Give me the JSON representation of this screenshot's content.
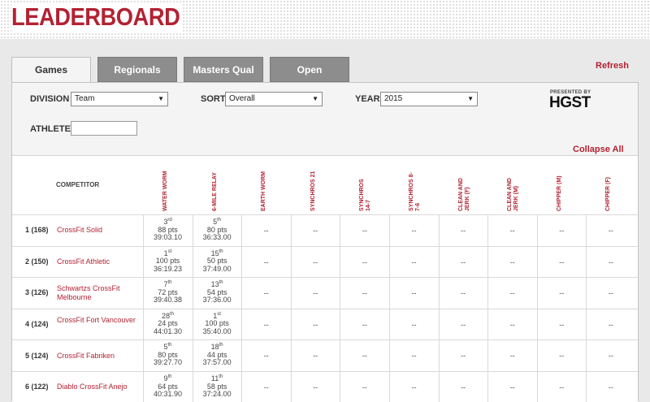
{
  "header": {
    "logo": "LEADERBOARD"
  },
  "tabs": [
    {
      "label": "Games",
      "active": true
    },
    {
      "label": "Regionals",
      "active": false
    },
    {
      "label": "Masters Qual",
      "active": false
    },
    {
      "label": "Open",
      "active": false
    }
  ],
  "refresh_label": "Refresh",
  "filters": {
    "division_label": "DIVISION",
    "division_value": "Team",
    "sort_label": "SORT",
    "sort_value": "Overall",
    "year_label": "YEAR",
    "year_value": "2015",
    "athlete_label": "ATHLETE",
    "athlete_value": ""
  },
  "sponsor": {
    "presented_by": "PRESENTED BY",
    "brand": "HGST"
  },
  "collapse_label": "Collapse All",
  "table": {
    "competitor_header": "COMPETITOR",
    "events": [
      "WATER WORM",
      "6-MILE RELAY",
      "EARTH WORM",
      "SYNCHROS 21",
      "SYNCHROS 14-7",
      "SYNCHROS 8-7-6",
      "CLEAN AND JERK (F)",
      "CLEAN AND JERK (M)",
      "CHIPPER (M)",
      "CHIPPER (F)"
    ],
    "rows": [
      {
        "rank": "1 (168)",
        "name": "CrossFit Solid",
        "scores": [
          {
            "place": "3",
            "suffix": "rd",
            "pts": "88 pts",
            "time": "39:03.10"
          },
          {
            "place": "5",
            "suffix": "th",
            "pts": "80 pts",
            "time": "36:33.00"
          }
        ]
      },
      {
        "rank": "2 (150)",
        "name": "CrossFit Athletic",
        "scores": [
          {
            "place": "1",
            "suffix": "st",
            "pts": "100 pts",
            "time": "36:19.23"
          },
          {
            "place": "15",
            "suffix": "th",
            "pts": "50 pts",
            "time": "37:49.00"
          }
        ]
      },
      {
        "rank": "3 (126)",
        "name": "Schwartzs CrossFit Melbourne",
        "scores": [
          {
            "place": "7",
            "suffix": "th",
            "pts": "72 pts",
            "time": "39:40.38"
          },
          {
            "place": "13",
            "suffix": "th",
            "pts": "54 pts",
            "time": "37:36.00"
          }
        ]
      },
      {
        "rank": "4 (124)",
        "name": "CrossFit Fort Vancouver",
        "scores": [
          {
            "place": "28",
            "suffix": "th",
            "pts": "24 pts",
            "time": "44:01.30"
          },
          {
            "place": "1",
            "suffix": "st",
            "pts": "100 pts",
            "time": "35:40.00"
          }
        ]
      },
      {
        "rank": "5 (124)",
        "name": "CrossFit Fabriken",
        "scores": [
          {
            "place": "5",
            "suffix": "th",
            "pts": "80 pts",
            "time": "39:27.70"
          },
          {
            "place": "18",
            "suffix": "th",
            "pts": "44 pts",
            "time": "37:57.00"
          }
        ]
      },
      {
        "rank": "6 (122)",
        "name": "Diablo CrossFit Anejo",
        "scores": [
          {
            "place": "9",
            "suffix": "th",
            "pts": "64 pts",
            "time": "40:31.90"
          },
          {
            "place": "11",
            "suffix": "th",
            "pts": "58 pts",
            "time": "37:24.00"
          }
        ]
      }
    ],
    "empty_cell": "--"
  }
}
